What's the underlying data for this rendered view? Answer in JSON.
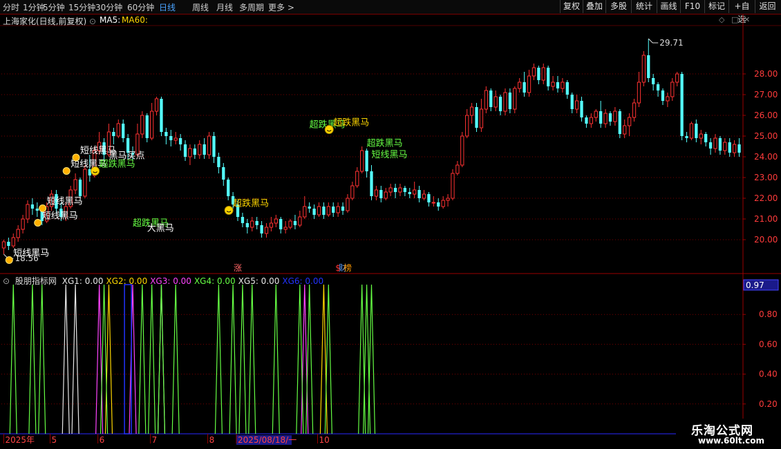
{
  "toolbar": {
    "periods": [
      "分时",
      "1分钟",
      "5分钟",
      "15分钟",
      "30分钟",
      "60分钟",
      "日线",
      "周线",
      "月线",
      "多周期",
      "更多 >"
    ],
    "active_period": "日线",
    "buttons": [
      "复权",
      "叠加",
      "多股",
      "统计",
      "画线",
      "F10",
      "标记",
      "+自选",
      "返回"
    ]
  },
  "stock": {
    "title": "上海家化(日线,前复权)",
    "ma5_label": "MA5:",
    "ma60_label": "MA60:"
  },
  "indicator": {
    "name": "股朋指标网",
    "values": [
      {
        "label": "XG1: 0.00",
        "color": "#e8e8e8"
      },
      {
        "label": "XG2: 0.00",
        "color": "#ffd700"
      },
      {
        "label": "XG3: 0.00",
        "color": "#ff44ff"
      },
      {
        "label": "XG4: 0.00",
        "color": "#66ff44"
      },
      {
        "label": "XG5: 0.00",
        "color": "#e8e8e8"
      },
      {
        "label": "XG6: 0.00",
        "color": "#2233ff"
      }
    ],
    "current_value": "0.97"
  },
  "watermark": {
    "line1": "乐淘公式网",
    "line2": "www.60lt.com"
  },
  "colors": {
    "up": "#ff3232",
    "down": "#54ffff",
    "grid": "#7a0000",
    "axis": "#9a0000"
  },
  "chart_data": [
    {
      "type": "candlestick",
      "ylim": [
        18.5,
        30.3
      ],
      "y_ticks": [
        "20.00",
        "21.00",
        "22.00",
        "23.00",
        "24.00",
        "25.00",
        "26.00",
        "27.00",
        "28.00"
      ],
      "high_label": "29.71",
      "low_label": "18.56",
      "candles": [
        [
          19.6,
          19.9,
          19.3,
          20.0
        ],
        [
          19.9,
          19.7,
          19.5,
          20.1
        ],
        [
          19.7,
          20.1,
          19.6,
          20.3
        ],
        [
          20.1,
          20.5,
          19.9,
          20.7
        ],
        [
          20.5,
          21.0,
          20.3,
          21.2
        ],
        [
          21.0,
          21.7,
          20.8,
          21.9
        ],
        [
          21.7,
          21.5,
          21.2,
          22.0
        ],
        [
          21.5,
          21.4,
          21.1,
          21.8
        ],
        [
          21.4,
          20.9,
          20.7,
          21.6
        ],
        [
          20.9,
          21.6,
          20.8,
          21.8
        ],
        [
          21.6,
          22.2,
          21.4,
          22.4
        ],
        [
          22.2,
          21.5,
          21.3,
          22.4
        ],
        [
          21.5,
          21.1,
          20.9,
          21.8
        ],
        [
          21.1,
          21.6,
          20.9,
          21.8
        ],
        [
          21.6,
          22.4,
          21.5,
          22.6
        ],
        [
          22.4,
          22.9,
          22.2,
          23.2
        ],
        [
          22.9,
          22.1,
          21.9,
          23.0
        ],
        [
          22.1,
          23.4,
          22.0,
          23.6
        ],
        [
          23.4,
          23.1,
          22.8,
          24.1
        ],
        [
          23.1,
          24.3,
          23.0,
          24.5
        ],
        [
          24.3,
          24.7,
          24.1,
          25.2
        ],
        [
          24.7,
          24.1,
          23.8,
          24.9
        ],
        [
          24.1,
          25.2,
          24.0,
          25.6
        ],
        [
          25.2,
          25.0,
          24.6,
          25.4
        ],
        [
          25.0,
          25.6,
          24.9,
          25.8
        ],
        [
          25.6,
          24.9,
          24.7,
          25.8
        ],
        [
          24.9,
          24.2,
          23.9,
          25.1
        ],
        [
          24.2,
          24.1,
          23.8,
          24.5
        ],
        [
          24.1,
          25.1,
          24.0,
          25.6
        ],
        [
          25.1,
          26.0,
          24.9,
          26.2
        ],
        [
          26.0,
          24.9,
          24.7,
          26.1
        ],
        [
          24.9,
          26.2,
          24.8,
          26.6
        ],
        [
          26.2,
          26.8,
          26.0,
          26.9
        ],
        [
          26.8,
          25.2,
          25.0,
          26.9
        ],
        [
          25.2,
          25.0,
          24.6,
          25.4
        ],
        [
          25.0,
          24.8,
          24.5,
          25.3
        ],
        [
          24.8,
          24.9,
          24.6,
          25.2
        ],
        [
          24.9,
          24.6,
          24.3,
          25.1
        ],
        [
          24.6,
          24.0,
          23.8,
          24.8
        ],
        [
          24.0,
          24.4,
          23.6,
          24.6
        ],
        [
          24.4,
          24.1,
          23.9,
          24.6
        ],
        [
          24.1,
          24.6,
          23.9,
          24.8
        ],
        [
          24.6,
          24.1,
          23.9,
          24.9
        ],
        [
          24.1,
          25.0,
          23.9,
          25.2
        ],
        [
          25.0,
          24.0,
          23.7,
          25.2
        ],
        [
          24.0,
          23.5,
          23.2,
          24.2
        ],
        [
          23.5,
          22.9,
          22.6,
          23.7
        ],
        [
          22.9,
          22.1,
          21.9,
          23.0
        ],
        [
          22.1,
          21.7,
          21.5,
          22.3
        ],
        [
          21.7,
          21.1,
          20.9,
          21.9
        ],
        [
          21.1,
          20.8,
          20.6,
          21.3
        ],
        [
          20.8,
          20.6,
          20.3,
          21.0
        ],
        [
          20.6,
          20.9,
          20.4,
          21.1
        ],
        [
          20.9,
          20.7,
          20.5,
          21.1
        ],
        [
          20.7,
          20.3,
          20.1,
          20.9
        ],
        [
          20.3,
          20.6,
          20.1,
          20.8
        ],
        [
          20.6,
          20.8,
          20.4,
          21.1
        ],
        [
          20.8,
          21.0,
          20.6,
          21.2
        ],
        [
          21.0,
          20.5,
          20.3,
          21.1
        ],
        [
          20.5,
          20.6,
          20.3,
          20.9
        ],
        [
          20.6,
          20.9,
          20.5,
          21.0
        ],
        [
          20.9,
          20.7,
          20.5,
          21.2
        ],
        [
          20.7,
          21.1,
          20.6,
          21.4
        ],
        [
          21.1,
          21.6,
          21.0,
          22.1
        ],
        [
          21.6,
          21.5,
          21.3,
          21.8
        ],
        [
          21.5,
          21.2,
          21.0,
          21.7
        ],
        [
          21.2,
          21.6,
          21.1,
          21.8
        ],
        [
          21.6,
          21.2,
          21.0,
          21.8
        ],
        [
          21.2,
          21.6,
          21.1,
          21.8
        ],
        [
          21.6,
          21.3,
          21.1,
          21.8
        ],
        [
          21.3,
          21.6,
          21.1,
          21.8
        ],
        [
          21.6,
          21.4,
          21.2,
          21.8
        ],
        [
          21.4,
          22.0,
          21.3,
          22.2
        ],
        [
          22.0,
          22.6,
          21.9,
          22.8
        ],
        [
          22.6,
          23.3,
          22.5,
          23.5
        ],
        [
          23.3,
          24.3,
          23.2,
          24.5
        ],
        [
          24.3,
          23.3,
          23.0,
          24.4
        ],
        [
          23.3,
          22.1,
          21.9,
          23.6
        ],
        [
          22.1,
          22.4,
          21.9,
          22.6
        ],
        [
          22.4,
          22.0,
          21.8,
          22.6
        ],
        [
          22.0,
          22.3,
          21.9,
          22.5
        ],
        [
          22.3,
          22.5,
          22.1,
          22.7
        ],
        [
          22.5,
          22.3,
          22.0,
          22.7
        ],
        [
          22.3,
          22.5,
          22.1,
          22.7
        ],
        [
          22.5,
          22.3,
          22.1,
          22.6
        ],
        [
          22.3,
          22.2,
          22.0,
          22.5
        ],
        [
          22.2,
          22.4,
          22.0,
          22.8
        ],
        [
          22.4,
          22.0,
          21.8,
          22.6
        ],
        [
          22.0,
          22.2,
          21.9,
          22.4
        ],
        [
          22.2,
          21.8,
          21.6,
          22.3
        ],
        [
          21.8,
          21.8,
          21.6,
          22.1
        ],
        [
          21.8,
          21.6,
          21.4,
          22.0
        ],
        [
          21.6,
          21.9,
          21.5,
          22.1
        ],
        [
          21.9,
          22.0,
          21.6,
          22.2
        ],
        [
          22.0,
          23.2,
          21.9,
          23.4
        ],
        [
          23.2,
          23.6,
          23.1,
          23.8
        ],
        [
          23.6,
          25.0,
          23.5,
          25.2
        ],
        [
          25.0,
          26.0,
          24.9,
          26.3
        ],
        [
          26.0,
          26.4,
          25.6,
          26.6
        ],
        [
          26.4,
          25.4,
          25.2,
          26.6
        ],
        [
          25.4,
          26.3,
          25.2,
          26.8
        ],
        [
          26.3,
          27.2,
          26.1,
          27.4
        ],
        [
          27.2,
          26.4,
          26.2,
          27.3
        ],
        [
          26.4,
          26.9,
          26.2,
          27.2
        ],
        [
          26.9,
          26.2,
          26.0,
          27.0
        ],
        [
          26.2,
          27.1,
          26.0,
          27.3
        ],
        [
          27.1,
          26.3,
          26.1,
          27.3
        ],
        [
          26.3,
          27.3,
          26.1,
          27.4
        ],
        [
          27.3,
          27.6,
          27.1,
          27.8
        ],
        [
          27.6,
          27.1,
          26.9,
          28.1
        ],
        [
          27.1,
          27.9,
          26.9,
          28.2
        ],
        [
          27.9,
          28.3,
          27.7,
          28.5
        ],
        [
          28.3,
          27.7,
          27.5,
          28.4
        ],
        [
          27.7,
          28.3,
          27.5,
          28.5
        ],
        [
          28.3,
          27.4,
          27.2,
          28.4
        ],
        [
          27.4,
          27.6,
          27.2,
          27.9
        ],
        [
          27.6,
          27.3,
          27.1,
          27.9
        ],
        [
          27.3,
          27.6,
          27.1,
          27.8
        ],
        [
          27.6,
          27.0,
          26.8,
          27.7
        ],
        [
          27.0,
          26.3,
          26.1,
          27.1
        ],
        [
          26.3,
          26.7,
          26.1,
          27.0
        ],
        [
          26.7,
          25.9,
          25.7,
          26.9
        ],
        [
          25.9,
          25.6,
          25.4,
          26.0
        ],
        [
          25.6,
          25.9,
          25.4,
          26.1
        ],
        [
          25.9,
          26.2,
          25.7,
          26.3
        ],
        [
          26.2,
          25.6,
          25.4,
          26.7
        ],
        [
          25.6,
          26.1,
          25.4,
          26.3
        ],
        [
          26.1,
          25.7,
          25.5,
          26.2
        ],
        [
          25.7,
          26.2,
          25.5,
          26.4
        ],
        [
          26.2,
          25.1,
          24.9,
          26.3
        ],
        [
          25.1,
          25.5,
          24.9,
          25.8
        ],
        [
          25.5,
          25.9,
          25.0,
          26.1
        ],
        [
          25.9,
          26.6,
          25.7,
          26.8
        ],
        [
          26.6,
          27.6,
          26.4,
          28.1
        ],
        [
          27.6,
          28.9,
          27.4,
          29.1
        ],
        [
          28.9,
          27.8,
          27.6,
          29.7
        ],
        [
          27.8,
          27.5,
          27.2,
          28.0
        ],
        [
          27.5,
          27.2,
          26.9,
          27.6
        ],
        [
          27.2,
          26.7,
          26.5,
          27.3
        ],
        [
          26.7,
          26.9,
          26.4,
          27.1
        ],
        [
          26.9,
          27.6,
          26.7,
          27.8
        ],
        [
          27.6,
          28.0,
          27.4,
          28.1
        ],
        [
          28.0,
          25.0,
          24.8,
          28.1
        ],
        [
          25.0,
          24.9,
          24.7,
          25.2
        ],
        [
          24.9,
          25.6,
          24.8,
          25.7
        ],
        [
          25.6,
          24.9,
          24.7,
          25.8
        ],
        [
          24.9,
          25.1,
          24.6,
          25.3
        ],
        [
          25.1,
          24.7,
          24.5,
          25.2
        ],
        [
          24.7,
          24.4,
          24.1,
          24.9
        ],
        [
          24.4,
          24.9,
          24.2,
          25.1
        ],
        [
          24.9,
          24.3,
          24.1,
          25.0
        ],
        [
          24.3,
          24.7,
          24.1,
          24.9
        ],
        [
          24.7,
          24.2,
          24.0,
          24.9
        ],
        [
          24.2,
          24.6,
          24.0,
          24.8
        ],
        [
          24.6,
          24.2,
          24.0,
          24.9
        ]
      ],
      "annotations": [
        {
          "text": "短线黑马",
          "color": "#ffffff",
          "price": 19.35,
          "candle": 2,
          "marker": "coin"
        },
        {
          "text": "短线黑马",
          "color": "#ffffff",
          "price": 21.15,
          "candle": 8,
          "marker": "coin"
        },
        {
          "text": "短线黑马",
          "color": "#ffffff",
          "price": 21.85,
          "candle": 9,
          "marker": "coin"
        },
        {
          "text": "短线黑马",
          "color": "#ffffff",
          "price": 23.65,
          "candle": 14,
          "marker": "coin"
        },
        {
          "text": "短线黑马",
          "color": "#ffffff",
          "price": 24.3,
          "candle": 16,
          "marker": "coin"
        },
        {
          "text": "超跌黑马",
          "color": "#66ff44",
          "price": 23.65,
          "candle": 20,
          "marker": "smiley"
        },
        {
          "text": "黑马买点",
          "color": "#ffffff",
          "price": 24.05,
          "candle": 22,
          "marker": "none"
        },
        {
          "text": "超跌黑马",
          "color": "#66ff44",
          "price": 20.8,
          "candle": 27,
          "marker": "none"
        },
        {
          "text": "大黑马",
          "color": "#ffffff",
          "price": 20.55,
          "candle": 30,
          "marker": "none"
        },
        {
          "text": "超跌黑马",
          "color": "#ffd700",
          "price": 21.75,
          "candle": 48,
          "marker": "smiley"
        },
        {
          "text": "超跌黑马",
          "color": "#66ff44",
          "price": 25.55,
          "candle": 64,
          "marker": "none"
        },
        {
          "text": "超跌黑马",
          "color": "#ffd700",
          "price": 25.65,
          "candle": 69,
          "marker": "smiley"
        },
        {
          "text": "超跌黑马",
          "color": "#66ff44",
          "price": 24.65,
          "candle": 76,
          "marker": "none"
        },
        {
          "text": "短线黑马",
          "color": "#66ff44",
          "price": 24.1,
          "candle": 77,
          "marker": "none"
        }
      ],
      "event_labels": [
        {
          "text": "涨",
          "color": "#ff6666",
          "candle": 49
        },
        {
          "text": "$",
          "color": "#ff3232",
          "candle": 70
        },
        {
          "text": "财",
          "color": "#5aa0ff",
          "candle": 71
        },
        {
          "text": "榜",
          "color": "#ff9900",
          "candle": 72
        }
      ]
    },
    {
      "type": "line",
      "title": "股朋指标网",
      "ylim": [
        0,
        1
      ],
      "y_ticks": [
        "0.20",
        "0.40",
        "0.60",
        "0.80"
      ],
      "current_value": "0.97",
      "series": [
        {
          "name": "XG1",
          "color": "#e8e8e8",
          "spikes": [
            13,
            15,
            33
          ]
        },
        {
          "name": "XG2",
          "color": "#ffd700",
          "spikes": [
            22,
            67
          ]
        },
        {
          "name": "XG3",
          "color": "#ff44ff",
          "spikes": [
            20,
            27,
            63
          ]
        },
        {
          "name": "XG4",
          "color": "#66ff44",
          "spikes": [
            2,
            6,
            8,
            21,
            29,
            31,
            33,
            36,
            45,
            48,
            50,
            52,
            57,
            62,
            64,
            68,
            75,
            76,
            77
          ]
        },
        {
          "name": "XG5",
          "color": "#e8e8e8",
          "spikes": []
        },
        {
          "name": "XG6",
          "color": "#2233ff",
          "spikes": [
            26
          ]
        }
      ]
    }
  ],
  "x_axis": {
    "labels": [
      {
        "text": "2025年",
        "candle": 0
      },
      {
        "text": "5",
        "candle": 10
      },
      {
        "text": "6",
        "candle": 20
      },
      {
        "text": "7",
        "candle": 31
      },
      {
        "text": "8",
        "candle": 43
      },
      {
        "text": "2025/08/18/一",
        "candle": 49
      },
      {
        "text": "10",
        "candle": 66
      }
    ]
  }
}
